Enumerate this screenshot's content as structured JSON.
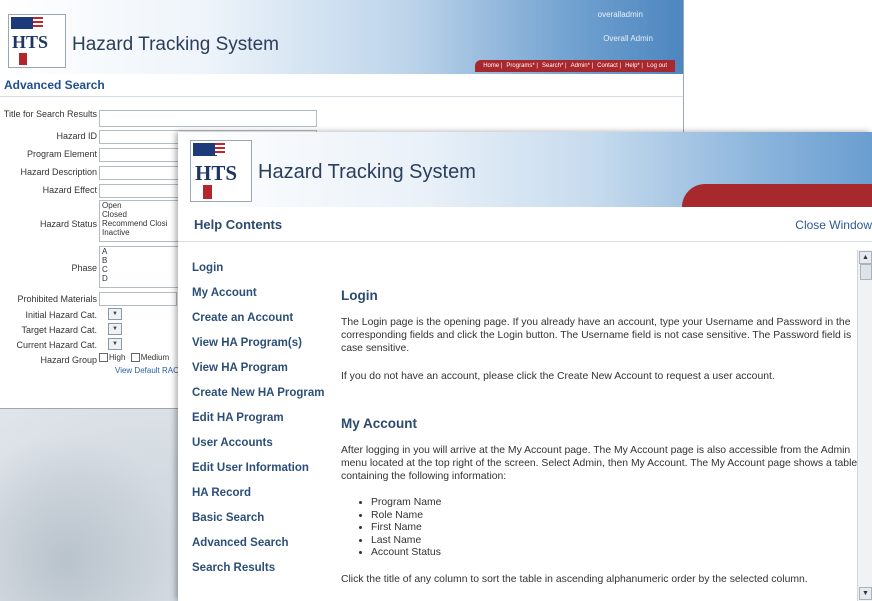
{
  "back_window": {
    "app_title": "Hazard Tracking System",
    "logo_text": "HTS",
    "user_name": "overalladmin",
    "user_role": "Overall Admin",
    "nav": [
      "Home |",
      "Programs* |",
      "Search* |",
      "Admin* |",
      "Contact |",
      "Help* |",
      "Log out"
    ],
    "section_title": "Advanced Search",
    "form": {
      "title_label": "Title for Search Results",
      "hazard_id_label": "Hazard ID",
      "program_element_label": "Program Element",
      "hazard_description_label": "Hazard Description",
      "hazard_effect_label": "Hazard Effect",
      "hazard_status_label": "Hazard Status",
      "hazard_status_options": [
        "Open",
        "Closed",
        "Recommend Closi",
        "Inactive"
      ],
      "phase_label": "Phase",
      "phase_options": [
        "A",
        "B",
        "C",
        "D"
      ],
      "prohibited_materials_label": "Prohibited Materials",
      "initial_hazard_label": "Initial Hazard Cat.",
      "target_hazard_label": "Target Hazard Cat.",
      "current_hazard_label": "Current Hazard Cat.",
      "hazard_group_label": "Hazard Group",
      "high_label": "High",
      "medium_label": "Medium",
      "view_default_rac": "View Default RAC I"
    }
  },
  "front_window": {
    "app_title": "Hazard Tracking System",
    "logo_text": "HTS",
    "help_title": "Help Contents",
    "close_window": "Close Window",
    "nav_items": [
      "Login",
      "My Account",
      "Create an Account",
      "View HA Program(s)",
      "View HA Program",
      "Create New HA Program",
      "Edit HA Program",
      "User Accounts",
      "Edit User Information",
      "HA Record",
      "Basic Search",
      "Advanced Search",
      "Search Results"
    ],
    "login": {
      "heading": "Login",
      "p1": "The Login page is the opening page. If you already have an account, type your Username and Password in the corresponding fields and click the Login button. The Username field is not case sensitive. The Password field is case sensitive.",
      "p2": "If you do not have an account, please click the Create New Account to request a user account."
    },
    "my_account": {
      "heading": "My Account",
      "p1": "After logging in you will arrive at the My Account page. The My Account page is also accessible from the Admin menu located at the top right of the screen. Select Admin, then My Account. The My Account page shows a table containing the following information:",
      "list": [
        "Program Name",
        "Role Name",
        "First Name",
        "Last Name",
        "Account Status"
      ],
      "p2": "Click the title of any column to sort the table in ascending alphanumeric order by the selected column."
    }
  }
}
